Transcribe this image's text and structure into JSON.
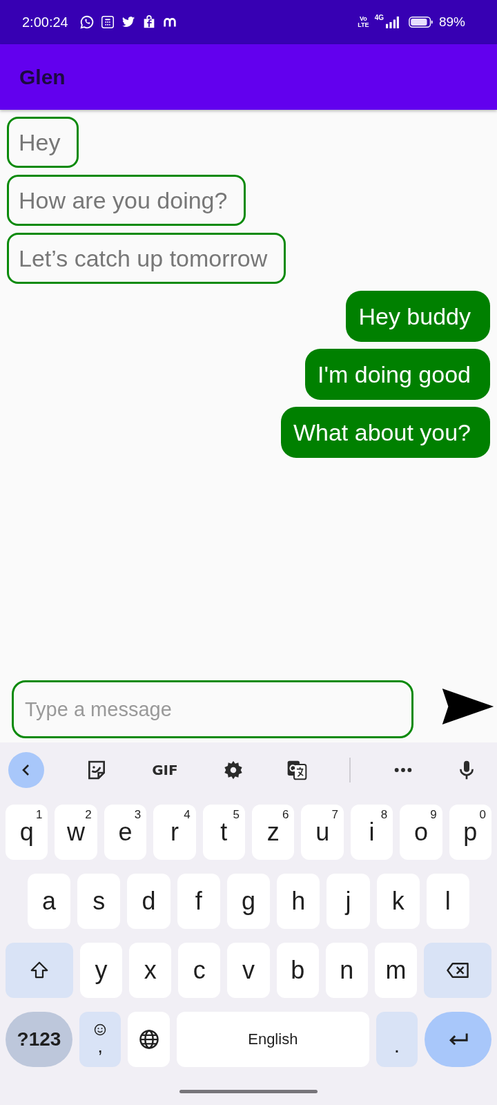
{
  "status_bar": {
    "time": "2:00:24",
    "volte_top": "Vo",
    "volte_bottom": "LTE",
    "network": "4G",
    "battery": "89%"
  },
  "app_bar": {
    "title": "Glen"
  },
  "messages": [
    {
      "text": "Hey",
      "kind": "received"
    },
    {
      "text": "How are you doing?",
      "kind": "received"
    },
    {
      "text": "Let’s catch up tomorrow",
      "kind": "received"
    },
    {
      "text": "Hey buddy",
      "kind": "sent"
    },
    {
      "text": "I'm doing good",
      "kind": "sent"
    },
    {
      "text": "What about you?",
      "kind": "sent"
    }
  ],
  "composer": {
    "placeholder": "Type a message"
  },
  "keyboard": {
    "toolbar": [
      {
        "kind": "back"
      },
      {
        "kind": "sticker"
      },
      {
        "kind": "gif",
        "label": "GIF"
      },
      {
        "kind": "settings"
      },
      {
        "kind": "translate"
      },
      {
        "kind": "divider"
      },
      {
        "kind": "more"
      },
      {
        "kind": "mic"
      }
    ],
    "key_rows": [
      {
        "keys": [
          {
            "kind": "letter",
            "label": "q",
            "hint": "1"
          },
          {
            "kind": "letter",
            "label": "w",
            "hint": "2"
          },
          {
            "kind": "letter",
            "label": "e",
            "hint": "3"
          },
          {
            "kind": "letter",
            "label": "r",
            "hint": "4"
          },
          {
            "kind": "letter",
            "label": "t",
            "hint": "5"
          },
          {
            "kind": "letter",
            "label": "z",
            "hint": "6"
          },
          {
            "kind": "letter",
            "label": "u",
            "hint": "7"
          },
          {
            "kind": "letter",
            "label": "i",
            "hint": "8"
          },
          {
            "kind": "letter",
            "label": "o",
            "hint": "9"
          },
          {
            "kind": "letter",
            "label": "p",
            "hint": "0"
          }
        ]
      },
      {
        "keys": [
          {
            "kind": "letter",
            "label": "a"
          },
          {
            "kind": "letter",
            "label": "s"
          },
          {
            "kind": "letter",
            "label": "d"
          },
          {
            "kind": "letter",
            "label": "f"
          },
          {
            "kind": "letter",
            "label": "g"
          },
          {
            "kind": "letter",
            "label": "h"
          },
          {
            "kind": "letter",
            "label": "j"
          },
          {
            "kind": "letter",
            "label": "k"
          },
          {
            "kind": "letter",
            "label": "l"
          }
        ]
      },
      {
        "keys": [
          {
            "kind": "shift"
          },
          {
            "kind": "letter",
            "label": "y"
          },
          {
            "kind": "letter",
            "label": "x"
          },
          {
            "kind": "letter",
            "label": "c"
          },
          {
            "kind": "letter",
            "label": "v"
          },
          {
            "kind": "letter",
            "label": "b"
          },
          {
            "kind": "letter",
            "label": "n"
          },
          {
            "kind": "letter",
            "label": "m"
          },
          {
            "kind": "backspace"
          }
        ]
      },
      {
        "keys": [
          {
            "kind": "symbols",
            "label": "?123"
          },
          {
            "kind": "emoji",
            "label": ","
          },
          {
            "kind": "globe"
          },
          {
            "kind": "space",
            "label": "English"
          },
          {
            "kind": "period",
            "label": "."
          },
          {
            "kind": "enter"
          }
        ]
      }
    ]
  }
}
